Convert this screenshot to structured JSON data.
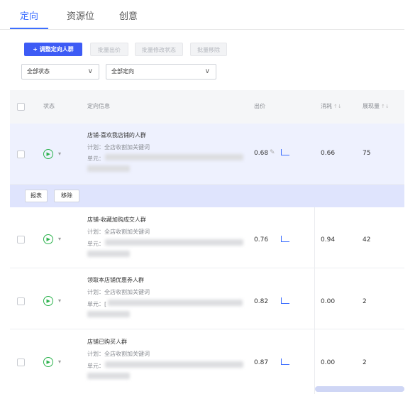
{
  "tabs": [
    {
      "label": "定向"
    },
    {
      "label": "资源位"
    },
    {
      "label": "创意"
    }
  ],
  "toolbar": {
    "adjust_label": "+ 调整定向人群",
    "batch_bid_label": "批量出价",
    "batch_status_label": "批量修改状态",
    "batch_remove_label": "批量移除"
  },
  "filters": {
    "status_value": "全部状态",
    "targeting_value": "全部定向"
  },
  "table": {
    "headers": {
      "status": "状态",
      "info": "定向信息",
      "bid": "出价",
      "cost": "消耗",
      "impressions": "展现量"
    },
    "rows": [
      {
        "name": "店铺-喜欢我店铺的人群",
        "plan": "计划：全店收割加关键词",
        "unit": "单元：",
        "bid": "0.68",
        "cost": "0.66",
        "impressions": "75"
      },
      {
        "name": "店铺-收藏加购成交人群",
        "plan": "计划：全店收割加关键词",
        "unit": "单元：",
        "bid": "0.76",
        "cost": "0.94",
        "impressions": "42"
      },
      {
        "name": "领取本店铺优惠券人群",
        "plan": "计划：全店收割加关键词",
        "unit": "单元：[",
        "bid": "0.82",
        "cost": "0.00",
        "impressions": "2"
      },
      {
        "name": "店铺已购买人群",
        "plan": "计划：全店收割加关键词",
        "unit": "单元：",
        "bid": "0.87",
        "cost": "0.00",
        "impressions": "2"
      }
    ]
  },
  "bulk_actions": {
    "report_label": "报表",
    "remove_label": "移除"
  },
  "colors": {
    "accent": "#3d6fff",
    "primary_button": "#3d5bf5",
    "status_green": "#2bb24c",
    "row_highlight": "#eef1fe"
  }
}
